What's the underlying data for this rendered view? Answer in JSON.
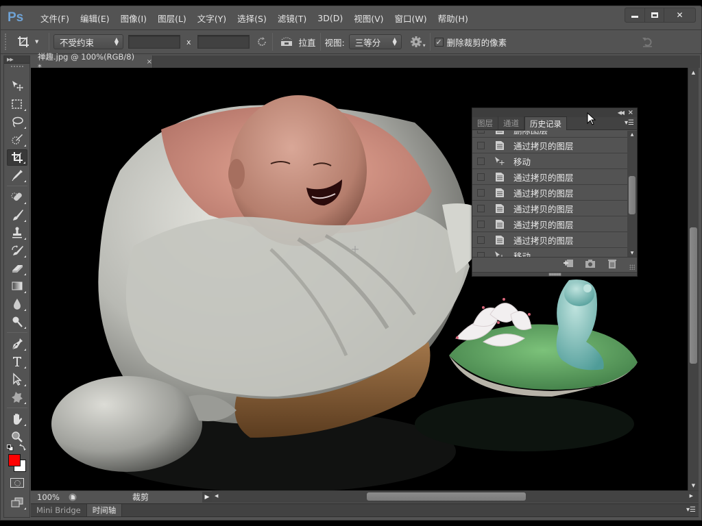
{
  "app": {
    "logo": "Ps",
    "menus": [
      "文件(F)",
      "编辑(E)",
      "图像(I)",
      "图层(L)",
      "文字(Y)",
      "选择(S)",
      "滤镜(T)",
      "3D(D)",
      "视图(V)",
      "窗口(W)",
      "帮助(H)"
    ],
    "window_controls": {
      "minimize": "▬",
      "maximize": "□",
      "close": "✕"
    }
  },
  "options_bar": {
    "active_tool_icon": "crop-icon",
    "ratio_preset": "不受约束",
    "width_value": "",
    "height_value": "",
    "separator_x": "x",
    "straighten_label": "拉直",
    "view_label": "视图:",
    "view_overlay": "三等分",
    "delete_cropped_pixels_label": "删除裁剪的像素",
    "delete_cropped_pixels_checked": true
  },
  "toolbox": {
    "tools": [
      {
        "name": "move-tool",
        "icon": "move-icon"
      },
      {
        "name": "rectangular-marquee-tool",
        "icon": "marquee-icon"
      },
      {
        "name": "lasso-tool",
        "icon": "lasso-icon"
      },
      {
        "name": "quick-selection-tool",
        "icon": "quick-selection-icon"
      },
      {
        "name": "crop-tool",
        "icon": "crop-icon",
        "active": true
      },
      {
        "name": "eyedropper-tool",
        "icon": "eyedropper-icon"
      },
      {
        "name": "spot-healing-tool",
        "icon": "bandage-icon"
      },
      {
        "name": "brush-tool",
        "icon": "brush-icon"
      },
      {
        "name": "clone-stamp-tool",
        "icon": "stamp-icon"
      },
      {
        "name": "history-brush-tool",
        "icon": "history-brush-icon"
      },
      {
        "name": "eraser-tool",
        "icon": "eraser-icon"
      },
      {
        "name": "gradient-tool",
        "icon": "gradient-icon"
      },
      {
        "name": "blur-tool",
        "icon": "drop-icon"
      },
      {
        "name": "dodge-tool",
        "icon": "dodge-icon"
      },
      {
        "name": "pen-tool",
        "icon": "pen-icon"
      },
      {
        "name": "type-tool",
        "icon": "type-icon"
      },
      {
        "name": "path-selection-tool",
        "icon": "arrow-icon"
      },
      {
        "name": "custom-shape-tool",
        "icon": "shape-icon"
      },
      {
        "name": "hand-tool",
        "icon": "hand-icon"
      },
      {
        "name": "zoom-tool",
        "icon": "zoom-icon"
      }
    ],
    "foreground_color": "#ff0000",
    "background_color": "#ffffff"
  },
  "document": {
    "tab_title": "禅趣.jpg @ 100%(RGB/8) *",
    "tab_close": "×"
  },
  "status": {
    "zoom": "100%",
    "info": "裁剪"
  },
  "bottom_panel": {
    "tabs": [
      "Mini Bridge",
      "时间轴"
    ],
    "active_tab": "时间轴"
  },
  "history_panel": {
    "tabs": [
      "图层",
      "通道",
      "历史记录"
    ],
    "active_tab": "历史记录",
    "items": [
      {
        "label": "删除图层",
        "icon": "layer-doc-icon"
      },
      {
        "label": "通过拷贝的图层",
        "icon": "layer-doc-icon"
      },
      {
        "label": "移动",
        "icon": "move-icon"
      },
      {
        "label": "通过拷贝的图层",
        "icon": "layer-doc-icon"
      },
      {
        "label": "通过拷贝的图层",
        "icon": "layer-doc-icon"
      },
      {
        "label": "通过拷贝的图层",
        "icon": "layer-doc-icon"
      },
      {
        "label": "通过拷贝的图层",
        "icon": "layer-doc-icon"
      },
      {
        "label": "通过拷贝的图层",
        "icon": "layer-doc-icon"
      },
      {
        "label": "移动",
        "icon": "move-icon"
      }
    ],
    "footer_buttons": [
      "new-document-from-state",
      "new-snapshot",
      "delete-state"
    ]
  }
}
